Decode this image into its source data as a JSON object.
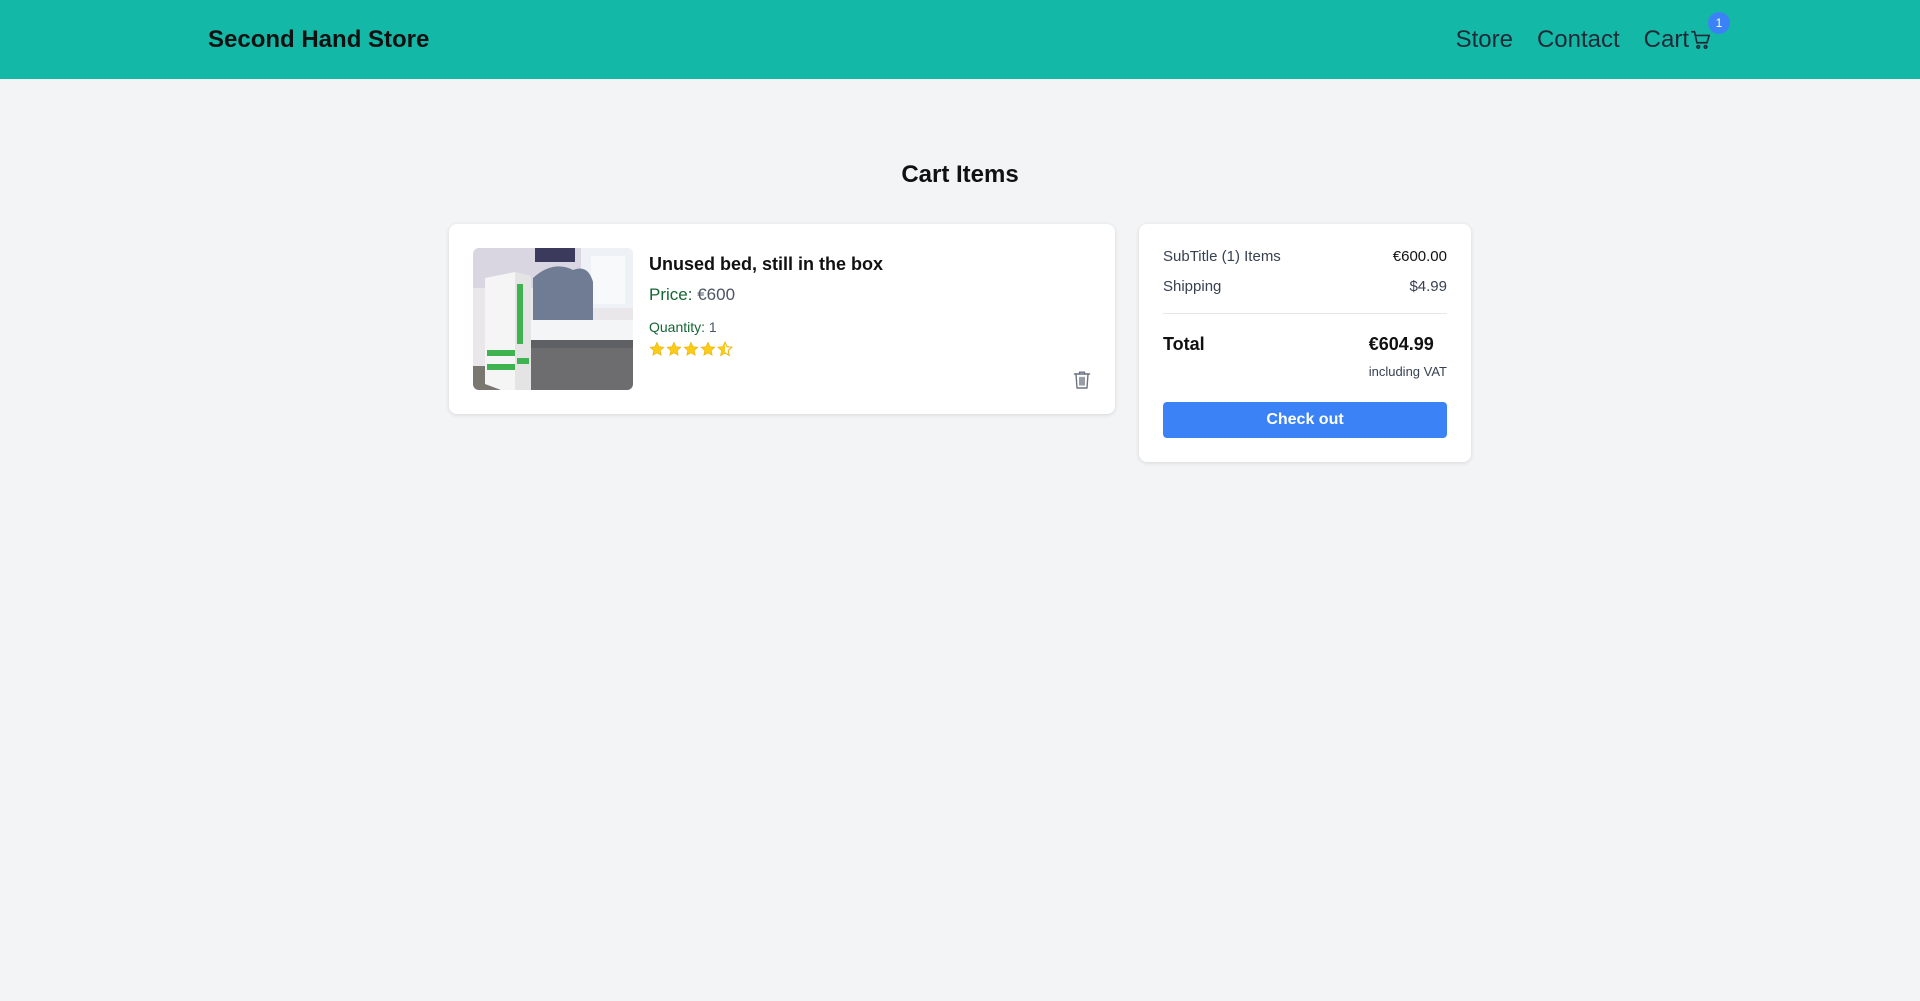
{
  "header": {
    "brand": "Second Hand Store",
    "nav": {
      "store": "Store",
      "contact": "Contact",
      "cart": "Cart"
    },
    "cart_count": "1",
    "background": "#14b8a6"
  },
  "page": {
    "title": "Cart Items"
  },
  "cart_items": [
    {
      "name": "Unused bed, still in the box",
      "price_label": "Price:",
      "price_value": "€600",
      "quantity_label": "Quantity:",
      "quantity_value": "1",
      "rating": 4.5,
      "rating_max": 5,
      "image_icon": "bed-in-box-photo"
    }
  ],
  "summary": {
    "subtotal_label": "SubTitle (1) Items",
    "subtotal_value": "€600.00",
    "shipping_label": "Shipping",
    "shipping_value": "$4.99",
    "total_label": "Total",
    "total_value": "€604.99",
    "vat_note": "including VAT",
    "checkout_label": "Check out",
    "accent": "#3b82f6"
  }
}
